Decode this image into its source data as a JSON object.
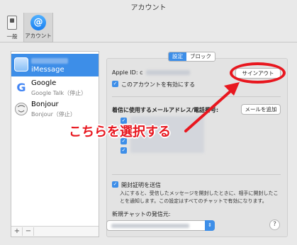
{
  "window": {
    "title": "アカウント"
  },
  "toolbar": {
    "general_label": "一般",
    "accounts_label": "アカウント"
  },
  "accounts": [
    {
      "name": "iMessage",
      "sub": ""
    },
    {
      "name": "Google",
      "sub": "Google Talk（停止）"
    },
    {
      "name": "Bonjour",
      "sub": "Bonjour（停止）"
    }
  ],
  "sidebar": {
    "add_label": "+",
    "remove_label": "−"
  },
  "tabs": {
    "settings": "設定",
    "block": "ブロック"
  },
  "settings": {
    "apple_id_label": "Apple ID: c",
    "signout_label": "サインアウト",
    "enable_account_label": "このアカウントを有効にする",
    "reach_label": "着信に使用するメールアドレス/電話番号:",
    "add_email_label": "メールを追加",
    "read_receipts_label": "開封証明を送信",
    "read_receipts_desc": "入にすると、受信したメッセージを開封したときに、相手に開封したことを通知します。この設定はすべてのチャットで有効になります。",
    "new_chat_from_label": "新規チャットの発信元:",
    "help_label": "?"
  },
  "annotation": {
    "callout": "こちらを選択する",
    "color": "#e8171f"
  }
}
